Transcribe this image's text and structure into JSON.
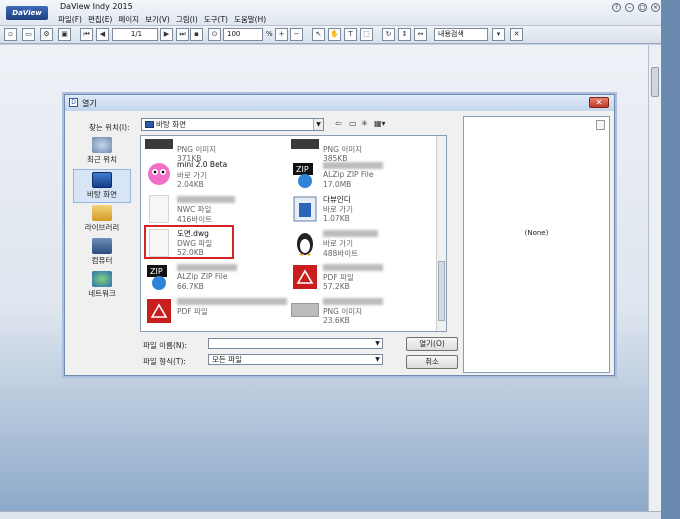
{
  "app": {
    "logo_text": "DaView",
    "title": "DaView Indy 2015",
    "menu": [
      "파일(F)",
      "편집(E)",
      "페이지",
      "보기(V)",
      "그림(I)",
      "도구(T)",
      "도움말(H)"
    ]
  },
  "toolbar": {
    "page_value": "1/1",
    "zoom_value": "100",
    "zoom_unit": "%",
    "search_value": "내용검색"
  },
  "dialog": {
    "title": "열기",
    "lookin_label": "찾는 위치(I):",
    "lookin_value": "바탕 화면",
    "places": [
      {
        "label": "최근 위치"
      },
      {
        "label": "바탕 화면"
      },
      {
        "label": "라이브러리"
      },
      {
        "label": "컴퓨터"
      },
      {
        "label": "네트워크"
      }
    ],
    "files_left": [
      {
        "l1": "",
        "l2": "PNG 이미지",
        "l3": "371KB"
      },
      {
        "l1": "mini 2.0 Beta",
        "l2": "바로 가기",
        "l3": "2.04KB"
      },
      {
        "l1": "",
        "l2": "NWC 파일",
        "l3": "416바이트"
      },
      {
        "l1": "도면.dwg",
        "l2": "DWG 파일",
        "l3": "52.0KB"
      },
      {
        "l1": "",
        "l2": "ALZip ZIP File",
        "l3": "66.7KB"
      },
      {
        "l1": "",
        "l2": "PDF 파일",
        "l3": ""
      }
    ],
    "files_right": [
      {
        "l1": "",
        "l2": "PNG 이미지",
        "l3": "385KB"
      },
      {
        "l1": "",
        "l2": "ALZip ZIP File",
        "l3": "17.0MB"
      },
      {
        "l1": "다뷰인디",
        "l2": "바로 가기",
        "l3": "1.07KB"
      },
      {
        "l1": "",
        "l2": "바로 가기",
        "l3": "488바이트"
      },
      {
        "l1": "",
        "l2": "PDF 파일",
        "l3": "57.2KB"
      },
      {
        "l1": "",
        "l2": "PNG 이미지",
        "l3": "23.6KB"
      }
    ],
    "preview_text": "(None)",
    "filename_label": "파일 이름(N):",
    "filename_value": "",
    "filetype_label": "파일 형식(T):",
    "filetype_value": "모든 파일",
    "open_button": "열기(O)",
    "cancel_button": "취소"
  }
}
